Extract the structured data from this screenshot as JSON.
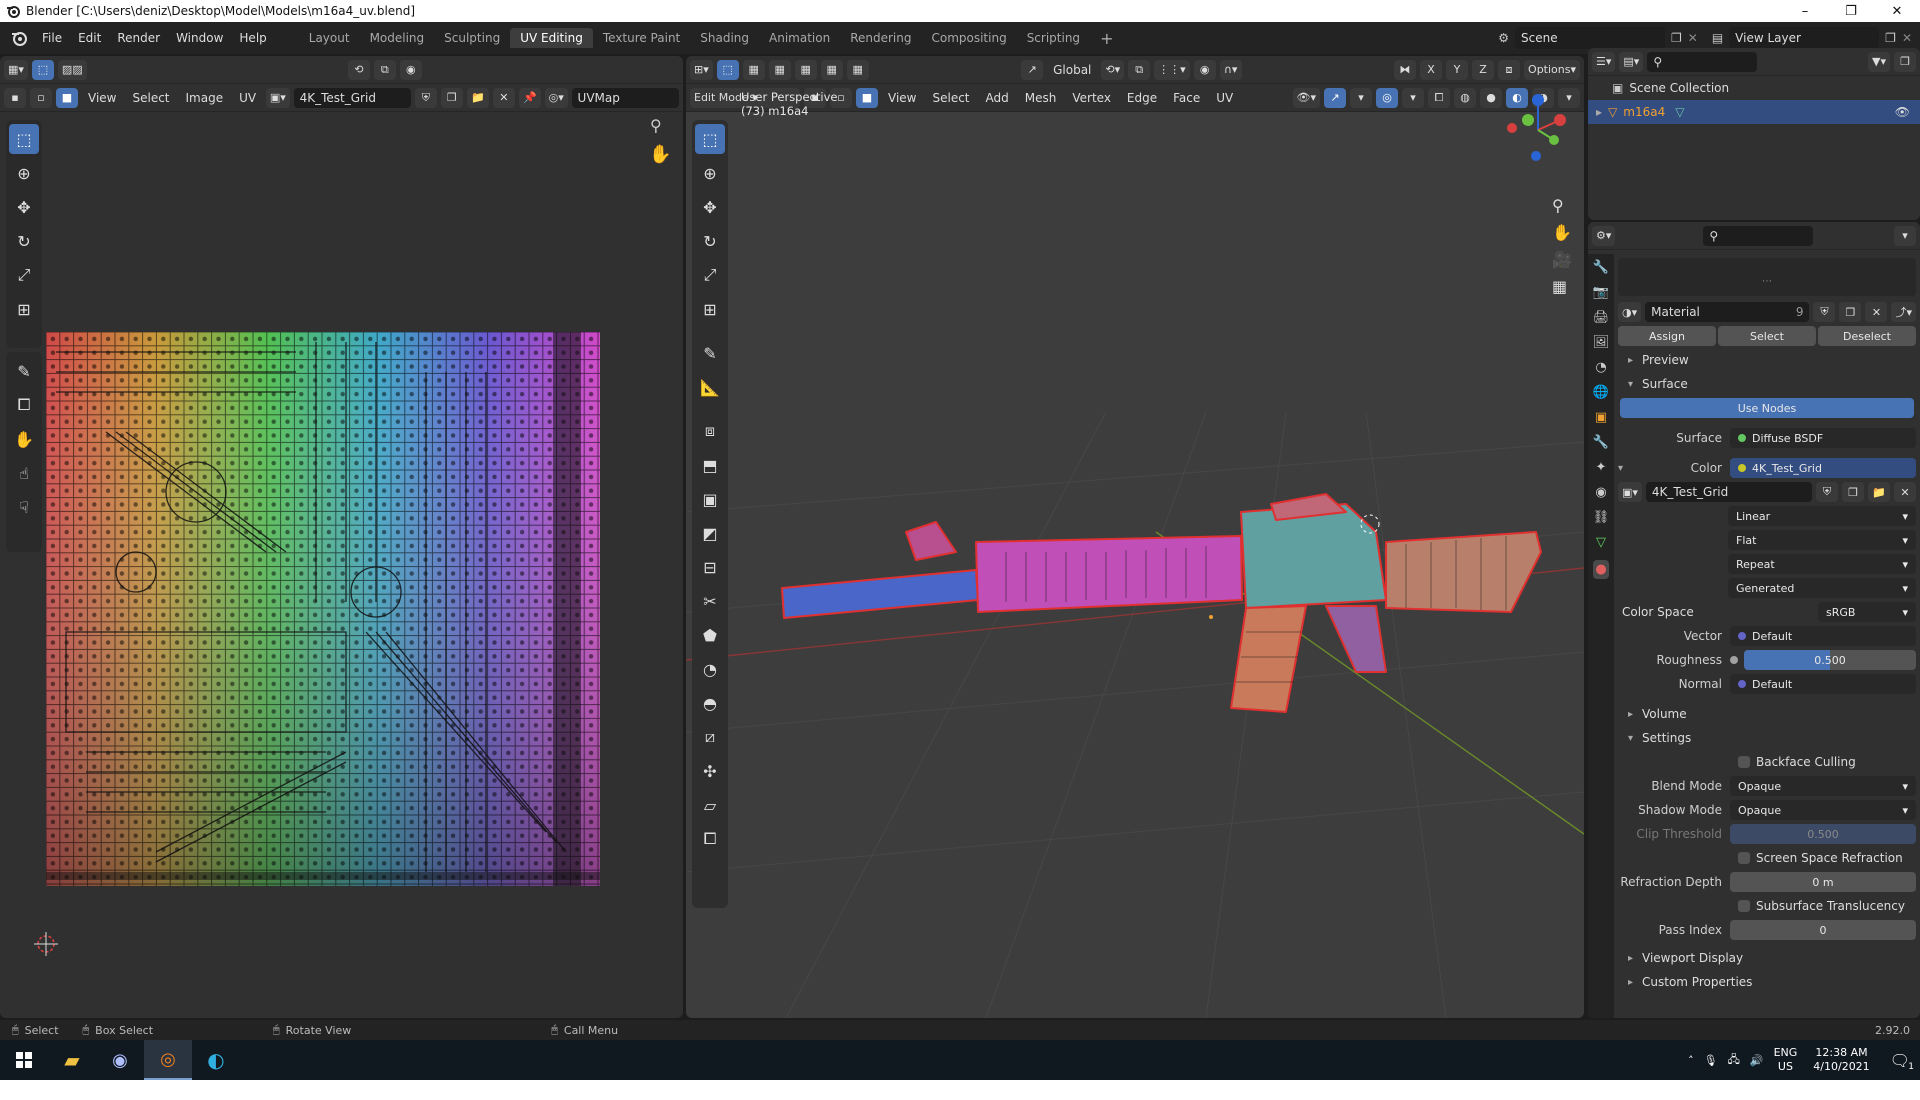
{
  "window": {
    "title": "Blender [C:\\Users\\deniz\\Desktop\\Model\\Models\\m16a4_uv.blend]",
    "minimize": "–",
    "maximize": "❐",
    "close": "✕"
  },
  "topbar": {
    "menus": [
      "File",
      "Edit",
      "Render",
      "Window",
      "Help"
    ],
    "workspaces": [
      "Layout",
      "Modeling",
      "Sculpting",
      "UV Editing",
      "Texture Paint",
      "Shading",
      "Animation",
      "Rendering",
      "Compositing",
      "Scripting"
    ],
    "active_workspace": "UV Editing",
    "add_tab": "+",
    "scene": "Scene",
    "view_layer": "View Layer"
  },
  "uv_editor": {
    "menus": [
      "View",
      "Select",
      "Image",
      "UV"
    ],
    "image_name": "4K_Test_Grid",
    "uv_map": "UVMap"
  },
  "viewport": {
    "orientation": "Global",
    "options_label": "Options",
    "mode": "Edit Mode",
    "menus": [
      "View",
      "Select",
      "Add",
      "Mesh",
      "Vertex",
      "Edge",
      "Face",
      "UV"
    ],
    "overlay_title": "User Perspective",
    "overlay_object": "(73) m16a4",
    "gizmo_axes": [
      "X",
      "Y",
      "Z"
    ]
  },
  "outliner": {
    "collection": "Scene Collection",
    "object": "m16a4"
  },
  "properties": {
    "material_slot": "Material",
    "users": "9",
    "assign": "Assign",
    "select": "Select",
    "deselect": "Deselect",
    "panels": {
      "preview": "Preview",
      "surface": "Surface",
      "volume": "Volume",
      "settings": "Settings",
      "viewport_display": "Viewport Display",
      "custom_properties": "Custom Properties"
    },
    "use_nodes": "Use Nodes",
    "surface_label": "Surface",
    "surface_value": "Diffuse BSDF",
    "color_label": "Color",
    "color_value": "4K_Test_Grid",
    "image_name": "4K_Test_Grid",
    "interpolation": "Linear",
    "projection": "Flat",
    "extension": "Repeat",
    "source": "Generated",
    "color_space_label": "Color Space",
    "color_space": "sRGB",
    "vector_label": "Vector",
    "vector_value": "Default",
    "roughness_label": "Roughness",
    "roughness_value": "0.500",
    "roughness_fraction": 0.5,
    "normal_label": "Normal",
    "normal_value": "Default",
    "backface_culling": "Backface Culling",
    "blend_mode_label": "Blend Mode",
    "blend_mode": "Opaque",
    "shadow_mode_label": "Shadow Mode",
    "shadow_mode": "Opaque",
    "clip_threshold_label": "Clip Threshold",
    "clip_threshold": "0.500",
    "screen_space_refraction": "Screen Space Refraction",
    "refraction_depth_label": "Refraction Depth",
    "refraction_depth": "0 m",
    "subsurface_translucency": "Subsurface Translucency",
    "pass_index_label": "Pass Index",
    "pass_index": "0"
  },
  "statusbar": {
    "select": "Select",
    "box_select": "Box Select",
    "rotate_view": "Rotate View",
    "call_menu": "Call Menu",
    "version": "2.92.0"
  },
  "taskbar": {
    "lang": "ENG",
    "region": "US",
    "time": "12:38 AM",
    "date": "4/10/2021",
    "notifications": "1"
  },
  "colors": {
    "accent": "#4772b3",
    "panel": "#303030",
    "header": "#232323",
    "mesh_wire": "#e03030"
  }
}
